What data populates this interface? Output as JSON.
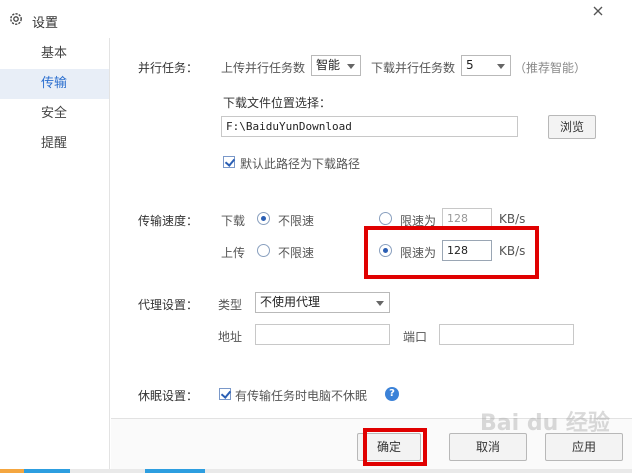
{
  "window": {
    "title": "设置",
    "close": "×"
  },
  "sidebar": {
    "items": [
      {
        "label": "基本",
        "active": false
      },
      {
        "label": "传输",
        "active": true
      },
      {
        "label": "安全",
        "active": false
      },
      {
        "label": "提醒",
        "active": false
      }
    ]
  },
  "parallel": {
    "label": "并行任务：",
    "upload_label": "上传并行任务数",
    "upload_value": "智能",
    "download_label": "下载并行任务数",
    "download_value": "5",
    "hint": "（推荐智能）"
  },
  "download_location": {
    "label": "下载文件位置选择：",
    "path": "F:\\BaiduYunDownload",
    "browse": "浏览",
    "default_checkbox": "默认此路径为下载路径",
    "default_checked": true
  },
  "speed": {
    "label": "传输速度：",
    "download_label": "下载",
    "upload_label": "上传",
    "unlimited": "不限速",
    "limit": "限速为",
    "download_limit_value": "128",
    "upload_limit_value": "128",
    "unit": "KB/s",
    "download_mode": "unlimited",
    "upload_mode": "limit"
  },
  "proxy": {
    "label": "代理设置：",
    "type_label": "类型",
    "type_value": "不使用代理",
    "address_label": "地址",
    "port_label": "端口"
  },
  "sleep": {
    "label": "休眠设置：",
    "checkbox_label": "有传输任务时电脑不休眠",
    "checked": true,
    "help": "?"
  },
  "footer": {
    "ok": "确定",
    "cancel": "取消",
    "apply": "应用"
  },
  "watermark": "Bai du 经验",
  "colors": {
    "accent": "#2c6fcf",
    "highlight": "#e00000"
  }
}
